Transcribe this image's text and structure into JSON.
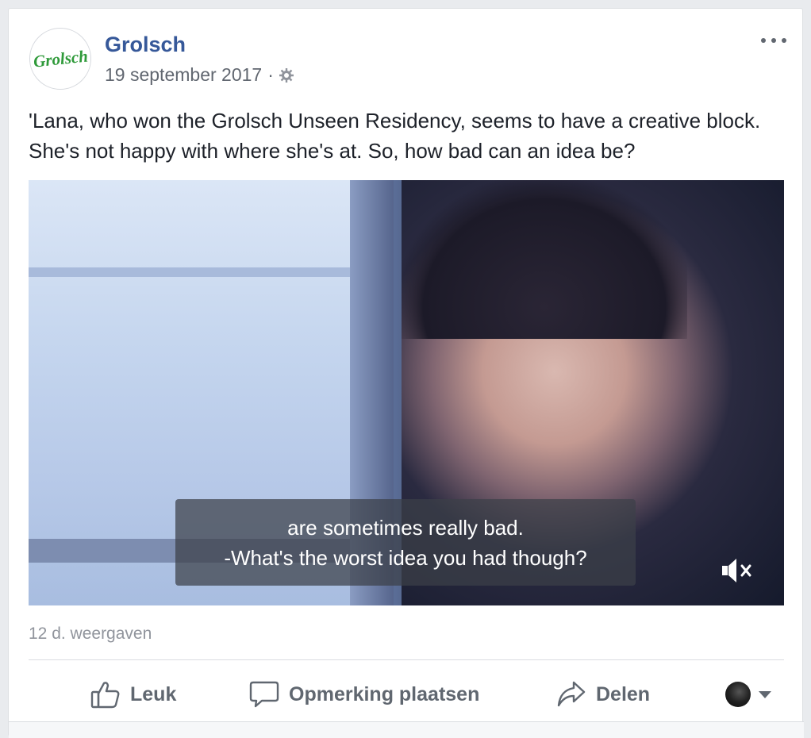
{
  "post": {
    "page_name": "Grolsch",
    "avatar_text": "Grolsch",
    "date": "19 september 2017",
    "separator": "·",
    "audience_icon": "globe-icon",
    "text": "'Lana, who won the Grolsch Unseen Residency, seems to have a creative block. She's not happy with where she's at. So, how bad can an idea be?"
  },
  "video": {
    "subtitle_line1": "are sometimes really bad.",
    "subtitle_line2": "-What's the worst idea you had though?",
    "mute_icon": "speaker-muted-icon"
  },
  "stats": {
    "views": "12 d. weergaven"
  },
  "actions": {
    "like_label": "Leuk",
    "comment_label": "Opmerking plaatsen",
    "share_label": "Delen"
  },
  "colors": {
    "page_name": "#365899",
    "brand_green": "#2f9a3a",
    "action_text": "#606770"
  }
}
